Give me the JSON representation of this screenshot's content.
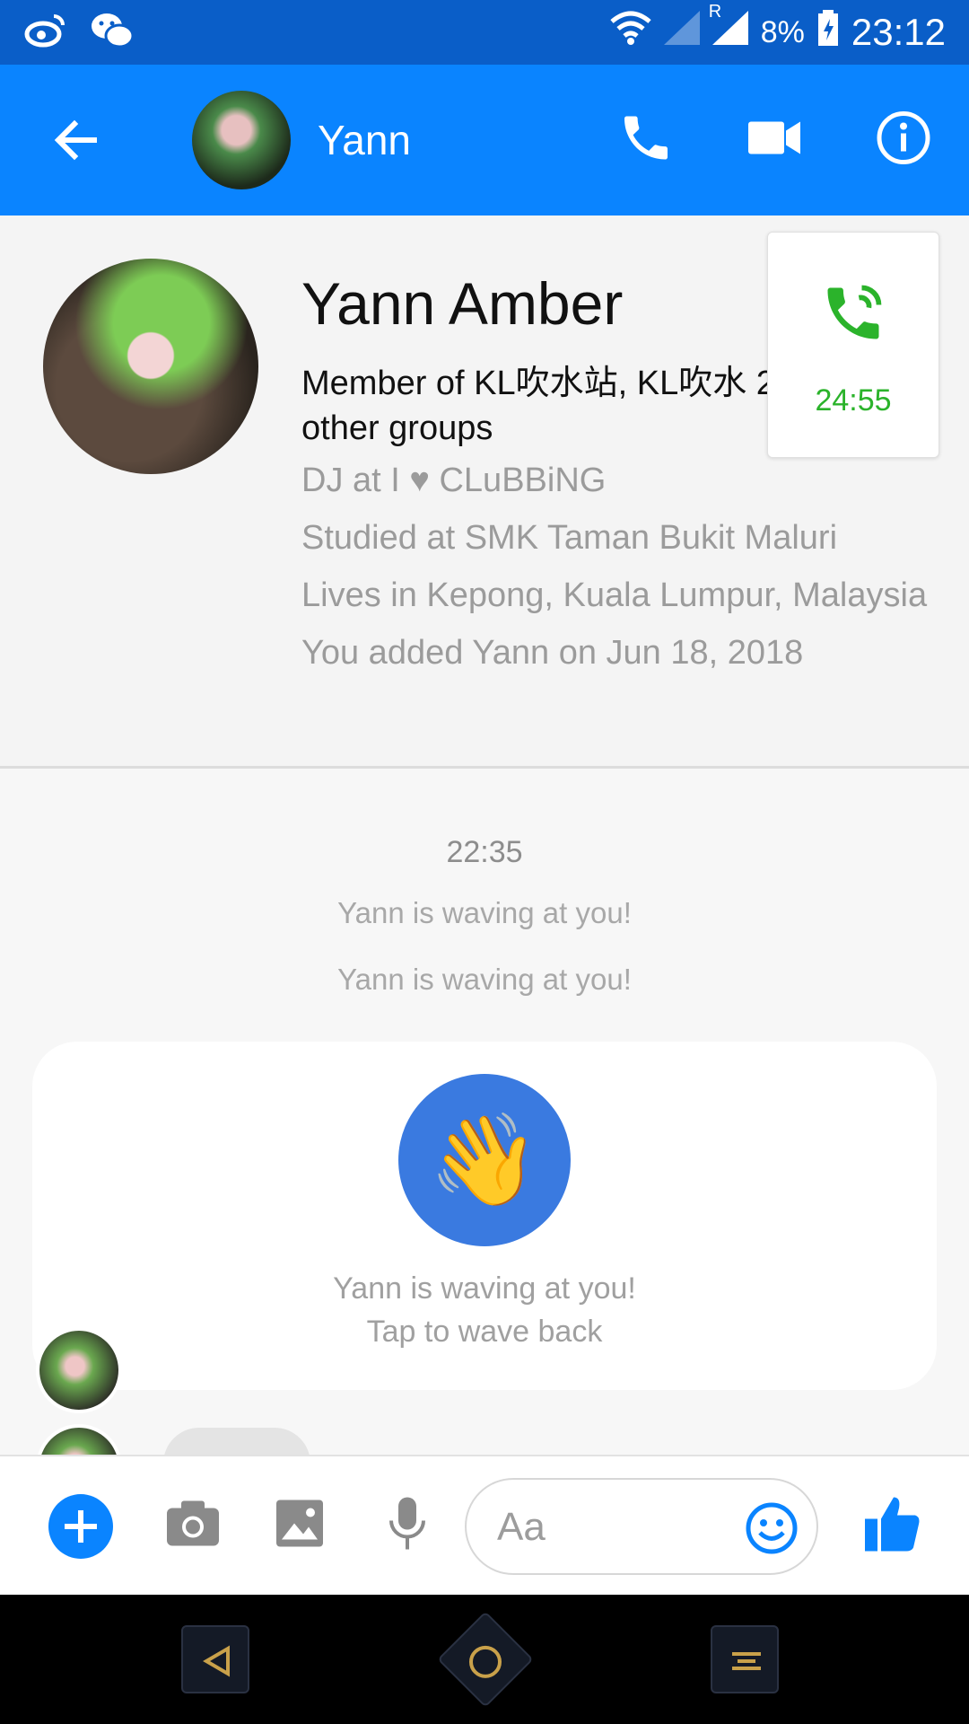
{
  "status_bar": {
    "battery": "8%",
    "time": "23:12",
    "signal_label": "R"
  },
  "header": {
    "name": "Yann"
  },
  "profile": {
    "full_name": "Yann Amber",
    "groups": "Member of KL吹水站, KL吹水 25 other groups",
    "job": "DJ at I ♥ CLuBBiNG",
    "education": "Studied at SMK Taman Bukit Maluri",
    "location": "Lives in Kepong, Kuala Lumpur, Malaysia",
    "added": "You added Yann on Jun 18, 2018"
  },
  "call_card": {
    "timer": "24:55"
  },
  "messages": {
    "timestamp": "22:35",
    "wave_notices": [
      "Yann is waving at you!",
      "Yann is waving at you!"
    ],
    "wave_card": {
      "line1": "Yann is waving at you!",
      "line2": "Tap to wave back",
      "emoji": "👋"
    }
  },
  "composer": {
    "placeholder": "Aa"
  },
  "colors": {
    "accent": "#0a84ff",
    "status_bar": "#0a5ec8",
    "call_green": "#2bb32b"
  }
}
